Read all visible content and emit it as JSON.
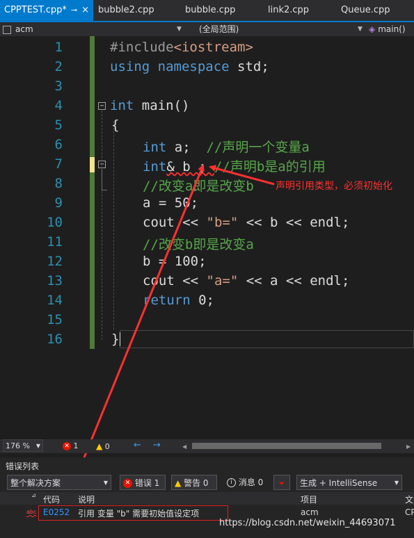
{
  "tabs": [
    {
      "label": "CPPTEST.cpp*",
      "active": true
    },
    {
      "label": "bubble2.cpp"
    },
    {
      "label": "bubble.cpp"
    },
    {
      "label": "link2.cpp"
    },
    {
      "label": "Queue.cpp"
    }
  ],
  "tab_pin": "⊸",
  "tab_close": "×",
  "nav": {
    "project": "acm",
    "scope": "(全局范围)",
    "function": "main()"
  },
  "code_lines": [
    {
      "num": "1"
    },
    {
      "num": "2"
    },
    {
      "num": "3"
    },
    {
      "num": "4"
    },
    {
      "num": "5"
    },
    {
      "num": "6"
    },
    {
      "num": "7"
    },
    {
      "num": "8"
    },
    {
      "num": "9"
    },
    {
      "num": "10"
    },
    {
      "num": "11"
    },
    {
      "num": "12"
    },
    {
      "num": "13"
    },
    {
      "num": "14"
    },
    {
      "num": "15"
    },
    {
      "num": "16"
    }
  ],
  "code": {
    "l1_a": "#include",
    "l1_b": "<iostream>",
    "l2_a": "using namespace",
    "l2_b": " std;",
    "l4_a": "int",
    "l4_b": " main()",
    "l5": "{",
    "l6_a": "int",
    "l6_b": " a;  ",
    "l6_c": "//声明一个变量a",
    "l7_a": "int",
    "l7_b": "& b ; ",
    "l7_c": "//声明b是a的引用",
    "l8": "//改变a即是改变b",
    "l9": "a = 50;",
    "l10_a": "cout << ",
    "l10_b": "\"b=\"",
    "l10_c": " << b << endl;",
    "l11": "//改变b即是改变a",
    "l12": "b = 100;",
    "l13_a": "cout << ",
    "l13_b": "\"a=\"",
    "l13_c": " << a << endl;",
    "l14_a": "return",
    "l14_b": " 0;",
    "l16": "}"
  },
  "annotation": "声明引用类型，必须初始化",
  "fold_symbol": "−",
  "status": {
    "zoom": "176 %",
    "errors": "1",
    "warnings": "0"
  },
  "error_panel": {
    "title": "错误列表",
    "scope": "整个解决方案",
    "errors_btn": "错误 1",
    "warnings_btn": "警告 0",
    "messages_btn": "消息 0",
    "build_filter": "生成 + IntelliSense",
    "headers": {
      "code": "代码",
      "desc": "说明",
      "project": "项目",
      "file": "文"
    },
    "row": {
      "code": "E0252",
      "desc": "引用 变量 \"b\" 需要初始值设定项",
      "project": "acm",
      "file": "CP"
    }
  },
  "watermark": "https://blog.csdn.net/weixin_44693071",
  "colors": {
    "accent": "#007acc",
    "keyword": "#569cd6",
    "comment": "#57a64a",
    "string": "#d69d85",
    "annotation": "#ff3030"
  }
}
